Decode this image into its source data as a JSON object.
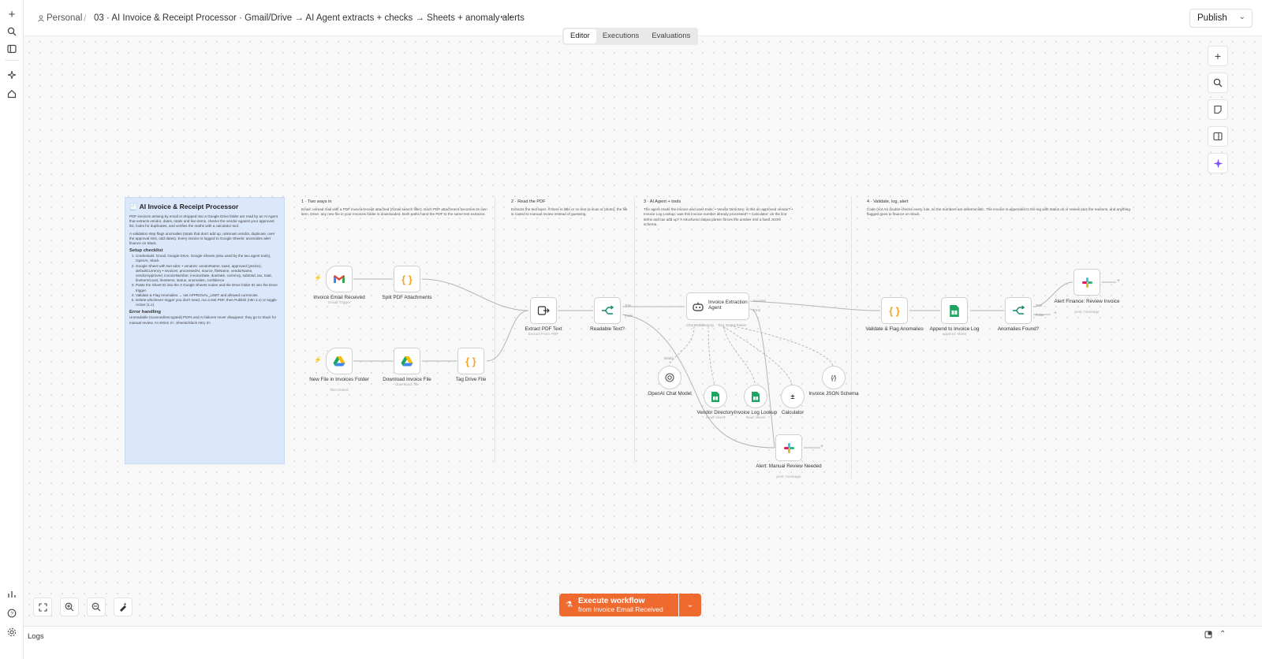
{
  "header": {
    "personal": "Personal",
    "title": "03 · AI Invoice & Receipt Processor · Gmail/Drive → AI Agent extracts + checks → Sheets + anomaly alerts",
    "publish": "Publish"
  },
  "tabs": [
    "Editor",
    "Executions",
    "Evaluations"
  ],
  "note": {
    "title": "AI Invoice & Receipt Processor",
    "p1": "PDF invoices arriving by email or dropped into a Google Drive folder are read by an AI Agent that extracts vendor, dates, totals and line items, checks the vendor against your approved list, looks for duplicates, and verifies the maths with a calculator tool.",
    "p2": "A validation step flags anomalies (totals that don't add up, unknown vendor, duplicate, over the approval limit, odd dates). Every invoice is logged to Google Sheets; anomalies alert finance on Slack.",
    "setup_heading": "Setup checklist",
    "setup": [
      "Credentials: Gmail, Google Drive, Google Sheets (also used by the two agent tools), OpenAI, Slack.",
      "Google Sheet with two tabs: • vendors: vendorName, taxId, approved (yes/no), defaultCurrency • invoices: processedAt, source, fileName, vendorName, vendorApproved, invoiceNumber, invoiceDate, dueDate, currency, subtotal, tax, total, lineItemCount, lineItems, status, anomalies, confidence",
      "Paste the Sheet ID into the 3 Google Sheets nodes and the Drive folder ID into the Drive trigger.",
      "Validate & Flag Anomalies → set APPROVAL_LIMIT and allowed currencies.",
      "Delete whichever trigger you don't need, run a test PDF, then Publish (n8n 2.x) or toggle Active (1.x)."
    ],
    "error_heading": "Error handling",
    "error": "Unreadable (scanned/encrypted) PDFs and AI failures never disappear: they go to Slack for manual review. AI retries 2×; Sheets/Slack retry 3×."
  },
  "sections": [
    {
      "title": "1 · Two ways in",
      "body": "Email: unread mail with a PDF invoice/receipt attached (Gmail search filter). Each PDF attachment becomes its own item. Drive: any new file in your Invoices folder is downloaded. Both paths hand the PDF to the same text extractor."
    },
    {
      "title": "2 · Read the PDF",
      "body": "Extracts the text layer. If there is little or no text (a scan or photo), the file is routed to manual review instead of guessing."
    },
    {
      "title": "3 · AI Agent + tools",
      "body": "The agent reads the invoice and uses tools: • Vendor Directory: is this an approved vendor? • Invoice Log Lookup: was this invoice number already processed? • Calculator: do the line items and tax add up? A structured output parser forces the answer into a fixed JSON schema."
    },
    {
      "title": "4 · Validate, log, alert",
      "body": "Code (not AI) double-checks every rule, so the numbers are deterministic. The invoice is appended to the log with status ok or review plus the reasons, and anything flagged goes to finance on Slack."
    }
  ],
  "nodes": {
    "gmail": {
      "label": "Invoice Email Received",
      "sub": "Gmail Trigger"
    },
    "split": {
      "label": "Split PDF Attachments"
    },
    "drive_trigger": {
      "label": "New File in Invoices Folder",
      "sub": "fileCreated"
    },
    "download": {
      "label": "Download Invoice File",
      "sub": "download: file"
    },
    "tag": {
      "label": "Tag Drive File"
    },
    "extract": {
      "label": "Extract PDF Text",
      "sub": "Extract From PDF"
    },
    "readable": {
      "label": "Readable Text?"
    },
    "agent": {
      "label": "Invoice Extraction Agent"
    },
    "openai": {
      "label": "OpenAI Chat Model"
    },
    "vendor_dir": {
      "label": "Vendor Directory",
      "sub": "read: sheet"
    },
    "log_lookup": {
      "label": "Invoice Log Lookup",
      "sub": "read: sheet"
    },
    "calculator": {
      "label": "Calculator"
    },
    "schema": {
      "label": "Invoice JSON Schema"
    },
    "validate": {
      "label": "Validate & Flag Anomalies"
    },
    "append": {
      "label": "Append to Invoice Log",
      "sub": "append: sheet"
    },
    "anomalies": {
      "label": "Anomalies Found?"
    },
    "alert_finance": {
      "label": "Alert Finance: Review Invoice",
      "sub": "post: message"
    },
    "alert_manual": {
      "label": "Alert: Manual Review Needed",
      "sub": "post: message"
    }
  },
  "edge_labels": {
    "true": "True",
    "false": "False",
    "success": "Success",
    "error": "Error",
    "chat_model": "Chat Model",
    "memory": "Memory",
    "tool": "Tool",
    "output_parser": "Output Parser",
    "model": "Model"
  },
  "execute": {
    "line1": "Execute workflow",
    "line2": "from Invoice Email Received"
  },
  "logs": "Logs",
  "colors": {
    "accent": "#ef6a2f",
    "note_bg": "#dbe8fb",
    "sheets_green": "#1fa463"
  }
}
